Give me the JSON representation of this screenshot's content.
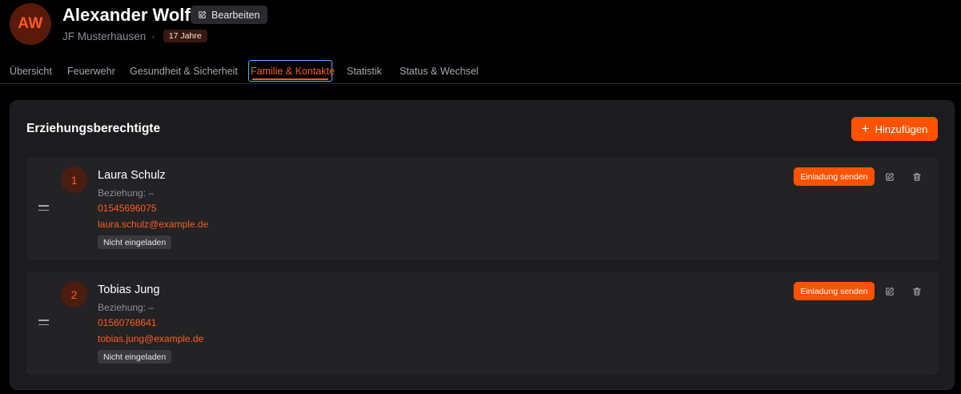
{
  "header": {
    "avatar_initials": "AW",
    "name": "Alexander Wolf",
    "edit_label": "Bearbeiten",
    "group": "JF Musterhausen",
    "separator": "·",
    "age_badge": "17 Jahre"
  },
  "tabs": [
    {
      "label": "Übersicht",
      "active": false
    },
    {
      "label": "Feuerwehr",
      "active": false
    },
    {
      "label": "Gesundheit & Sicherheit",
      "active": false
    },
    {
      "label": "Familie & Kontakte",
      "active": true
    },
    {
      "label": "Statistik",
      "active": false
    },
    {
      "label": "Status & Wechsel",
      "active": false
    }
  ],
  "section": {
    "title": "Erziehungsberechtigte",
    "add_label": "Hinzufügen"
  },
  "contacts": [
    {
      "index": "1",
      "name": "Laura Schulz",
      "relation": "Beziehung: –",
      "phone": "01545696075",
      "email": "laura.schulz@example.de",
      "status": "Nicht eingeladen",
      "invite_label": "Einladung senden"
    },
    {
      "index": "2",
      "name": "Tobias Jung",
      "relation": "Beziehung: –",
      "phone": "01560768641",
      "email": "tobias.jung@example.de",
      "status": "Nicht eingeladen",
      "invite_label": "Einladung senden"
    }
  ],
  "icons": {
    "edit": "pencil-square-icon",
    "delete": "trash-icon",
    "drag": "drag-handle-icon",
    "add": "plus-icon"
  },
  "colors": {
    "accent": "#ff5200",
    "accent_text": "#ff5a1f",
    "background": "#000000",
    "card": "#1c1c1e",
    "contact_row": "#232325",
    "focus_ring": "#6aa9ff"
  }
}
